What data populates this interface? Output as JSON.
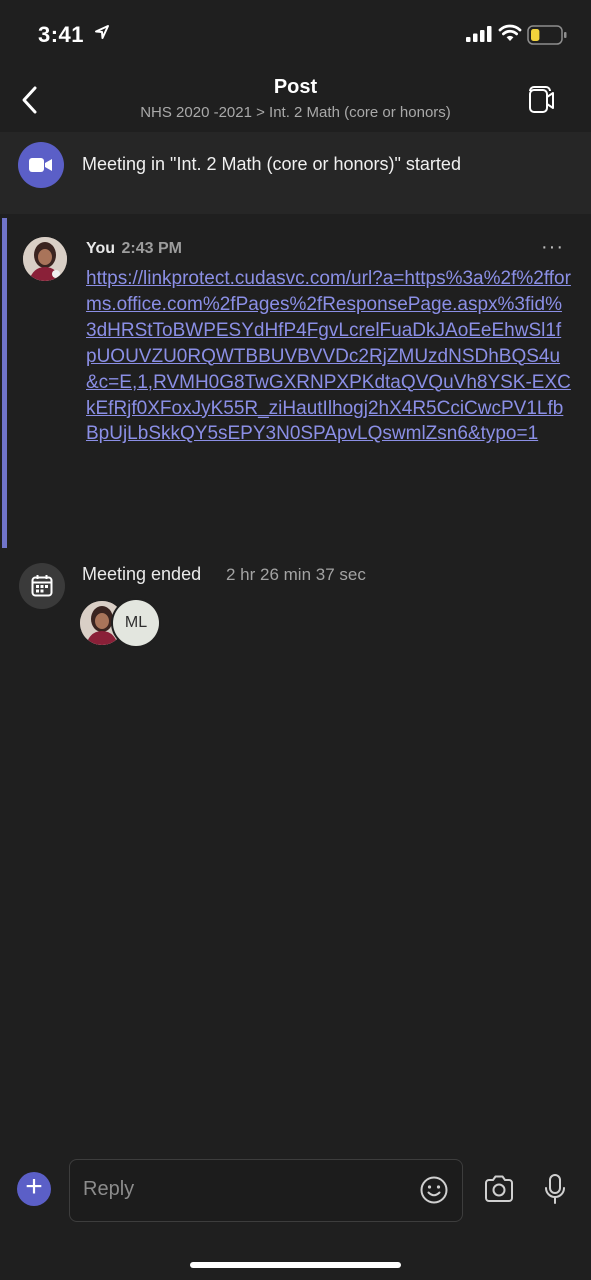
{
  "status_bar": {
    "time": "3:41",
    "battery_level": 0.3,
    "battery_color": "#f2d33c"
  },
  "header": {
    "title": "Post",
    "subtitle": "NHS 2020 -2021 > Int. 2 Math (core or honors)",
    "back_icon": "chevron-left-icon",
    "video_icon": "video-call-icon"
  },
  "banner": {
    "text": "Meeting in \"Int. 2 Math (core or honors)\"  started",
    "icon": "video-camera-icon",
    "icon_color": "#5b5fc7"
  },
  "message": {
    "author": "You",
    "time": "2:43 PM",
    "more_label": "···",
    "link_text": "https://linkprotect.cudasvc.com/url?a=https%3a%2f%2fforms.office.com%2fPages%2fResponsePage.aspx%3fid%3dHRStToBWPESYdHfP4FgvLcrelFuaDkJAoEeEhwSl1fpUOUVZU0RQWTBBUVBVVDc2RjZMUzdNSDhBQS4u&c=E,1,RVMH0G8TwGXRNPXPKdtaQVQuVh8YSK-EXCkEfRjf0XFoxJyK55R_ziHautIlhogj2hX4R5CciCwcPV1LfbBpUjLbSkkQY5sEPY3N0SPApvLQswmlZsn6&typo=1",
    "link_color": "#8b8fe6",
    "accent_bar_color": "#7074c9"
  },
  "meeting_ended": {
    "label": "Meeting ended",
    "duration": "2 hr 26 min 37 sec",
    "icon": "calendar-icon",
    "participant_initials": "ML"
  },
  "compose": {
    "placeholder": "Reply",
    "add_icon": "plus-icon",
    "emoji_icon": "emoji-icon",
    "camera_icon": "camera-icon",
    "mic_icon": "microphone-icon"
  }
}
